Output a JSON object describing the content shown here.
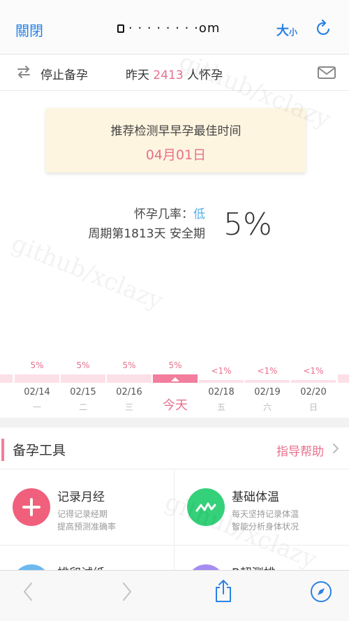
{
  "browser": {
    "close_label": "關閉",
    "url": "· · · · · · · ·om",
    "text_size_big": "大",
    "text_size_small": "小"
  },
  "header": {
    "stop_label": "停止备孕",
    "yesterday_prefix": "昨天 ",
    "yesterday_count": "2413",
    "yesterday_suffix": " 人怀孕"
  },
  "recommend": {
    "title": "推荐检测早早孕最佳时间",
    "date": "04月01日"
  },
  "probability": {
    "label": "怀孕几率：",
    "level": "低",
    "cycle": "周期第1813天 安全期",
    "value": "5%"
  },
  "calendar": [
    {
      "pct": "5%",
      "date": "02/14",
      "weekday": "一",
      "fill": 0.3
    },
    {
      "pct": "5%",
      "date": "02/15",
      "weekday": "二",
      "fill": 0.3
    },
    {
      "pct": "5%",
      "date": "02/16",
      "weekday": "三",
      "fill": 0.3
    },
    {
      "pct": "5%",
      "today": "今天",
      "fill": 0.3
    },
    {
      "pct": "<1%",
      "date": "02/18",
      "weekday": "五",
      "fill": 0.1
    },
    {
      "pct": "<1%",
      "date": "02/19",
      "weekday": "六",
      "fill": 0.1
    },
    {
      "pct": "<1%",
      "date": "02/20",
      "weekday": "日",
      "fill": 0.1
    }
  ],
  "tools": {
    "title": "备孕工具",
    "help": "指导帮助",
    "items": [
      {
        "title": "记录月经",
        "desc1": "记得记录经期",
        "desc2": "提高预测准确率",
        "color": "#f0607c",
        "icon": "plus-icon"
      },
      {
        "title": "基础体温",
        "desc1": "每天坚持记录体温",
        "desc2": "智能分析身体状况",
        "color": "#34d17a",
        "icon": "pulse-icon"
      },
      {
        "title": "排卵试纸",
        "desc1": "",
        "desc2": "",
        "color": "#6cb8ef",
        "icon": "test-strip-icon"
      },
      {
        "title": "B超测排",
        "desc1": "",
        "desc2": "",
        "color": "#a58cf0",
        "icon": "ultrasound-icon"
      }
    ]
  },
  "watermark": "github/xclazy",
  "colors": {
    "accent_pink": "#e8708e",
    "accent_blue": "#2a82e4",
    "probability_blue": "#4fb0e6"
  }
}
